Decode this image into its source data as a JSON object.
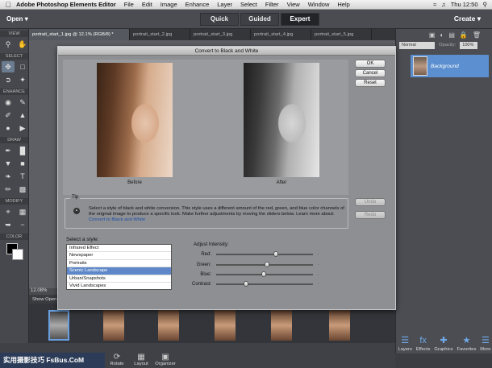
{
  "menubar": {
    "app_name": "Adobe Photoshop Elements Editor",
    "items": [
      "File",
      "Edit",
      "Image",
      "Enhance",
      "Layer",
      "Select",
      "Filter",
      "View",
      "Window",
      "Help"
    ],
    "clock": "Thu 12:50"
  },
  "topbar": {
    "open_label": "Open",
    "modes": [
      "Quick",
      "Guided",
      "Expert"
    ],
    "active_mode": "Expert",
    "create_label": "Create"
  },
  "toolbox": {
    "sections": [
      "VIEW",
      "SELECT",
      "ENHANCE",
      "DRAW",
      "MODIFY",
      "COLOR"
    ]
  },
  "tabs": [
    "portrait_start_1.jpg @ 12.1% (RGB/8) *",
    "portrait_start_2.jpg",
    "portrait_start_3.jpg",
    "portrait_start_4.jpg",
    "portrait_start_5.jpg"
  ],
  "status": {
    "zoom": "12.08%",
    "show_open": "Show Open"
  },
  "layers_panel": {
    "blend_mode": "Normal",
    "opacity_label": "Opacity:",
    "opacity_value": "100%",
    "layer_name": "Background",
    "buttons": [
      "Layers",
      "Effects",
      "Graphics",
      "Favorites",
      "More"
    ]
  },
  "bottombar": {
    "buttons": [
      "Rotate",
      "Layout",
      "Organizer"
    ]
  },
  "watermark": {
    "left": "实用摄影技巧 FsBus.CoM"
  },
  "dialog": {
    "title": "Convert to Black and White",
    "before_caption": "Before",
    "after_caption": "After",
    "ok": "OK",
    "cancel": "Cancel",
    "reset": "Reset",
    "undo": "Undo",
    "redo": "Redo",
    "tip_label": "Tip",
    "tip_text": "Select a style of black and white conversion. This style uses a different amount of the red, green, and blue color channels of the original image to produce a specific look. Make further adjustments by moving the sliders below. Learn more about:",
    "tip_link": "Convert to Black and White",
    "style_label": "Select a style:",
    "styles": [
      "Infrared Effect",
      "Newspaper",
      "Portraits",
      "Scenic Landscape",
      "Urban/Snapshots",
      "Vivid Landscapes"
    ],
    "selected_style": "Scenic Landscape",
    "intensity_label": "Adjust Intensity:",
    "sliders": [
      {
        "label": "Red:",
        "value": 0.62
      },
      {
        "label": "Green:",
        "value": 0.53
      },
      {
        "label": "Blue:",
        "value": 0.49
      },
      {
        "label": "Contrast:",
        "value": 0.3
      }
    ]
  }
}
